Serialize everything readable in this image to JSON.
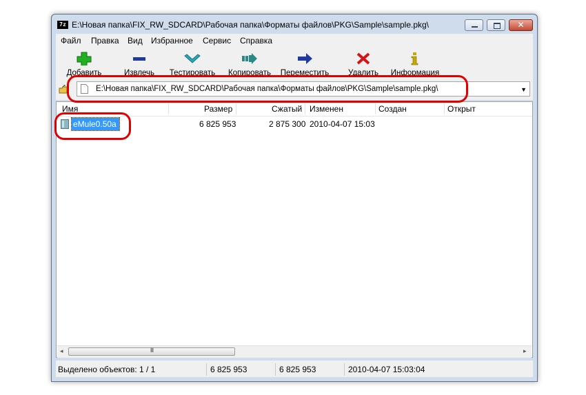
{
  "window": {
    "title": "E:\\Новая папка\\FIX_RW_SDCARD\\Рабочая папка\\Форматы файлов\\PKG\\Sample\\sample.pkg\\",
    "app_icon_text": "7z",
    "close_glyph": "✕"
  },
  "menu": [
    "Файл",
    "Правка",
    "Вид",
    "Избранное",
    "Сервис",
    "Справка"
  ],
  "toolbar": [
    {
      "label": "Добавить",
      "icon": "plus-icon",
      "color": "#22b022"
    },
    {
      "label": "Извлечь",
      "icon": "minus-icon",
      "color": "#1f3a9e"
    },
    {
      "label": "Тестировать",
      "icon": "check-icon",
      "color": "#2aa7b5"
    },
    {
      "label": "Копировать",
      "icon": "copy-arrow-icon",
      "color": "#2a8a8a"
    },
    {
      "label": "Переместить",
      "icon": "move-arrow-icon",
      "color": "#1f3a9e"
    },
    {
      "label": "Удалить",
      "icon": "delete-x-icon",
      "color": "#d41515"
    },
    {
      "label": "Информация",
      "icon": "info-icon",
      "color": "#c8a800"
    }
  ],
  "address": {
    "path": "E:\\Новая папка\\FIX_RW_SDCARD\\Рабочая папка\\Форматы файлов\\PKG\\Sample\\sample.pkg\\"
  },
  "columns": [
    "Имя",
    "Размер",
    "Сжатый",
    "Изменен",
    "Создан",
    "Открыт"
  ],
  "files": [
    {
      "name": "eMule0.50a",
      "size": "6 825 953",
      "packed": "2 875 300",
      "modified": "2010-04-07 15:03",
      "created": "",
      "accessed": ""
    }
  ],
  "scrollbar": {
    "left_arrow": "◂",
    "right_arrow": "▸",
    "grip": "III"
  },
  "status": {
    "selected": "Выделено объектов: 1 / 1",
    "size": "6 825 953",
    "total": "6 825 953",
    "date": "2010-04-07 15:03:04"
  },
  "colors": {
    "selection": "#3399ff",
    "annotation": "#e00000"
  }
}
